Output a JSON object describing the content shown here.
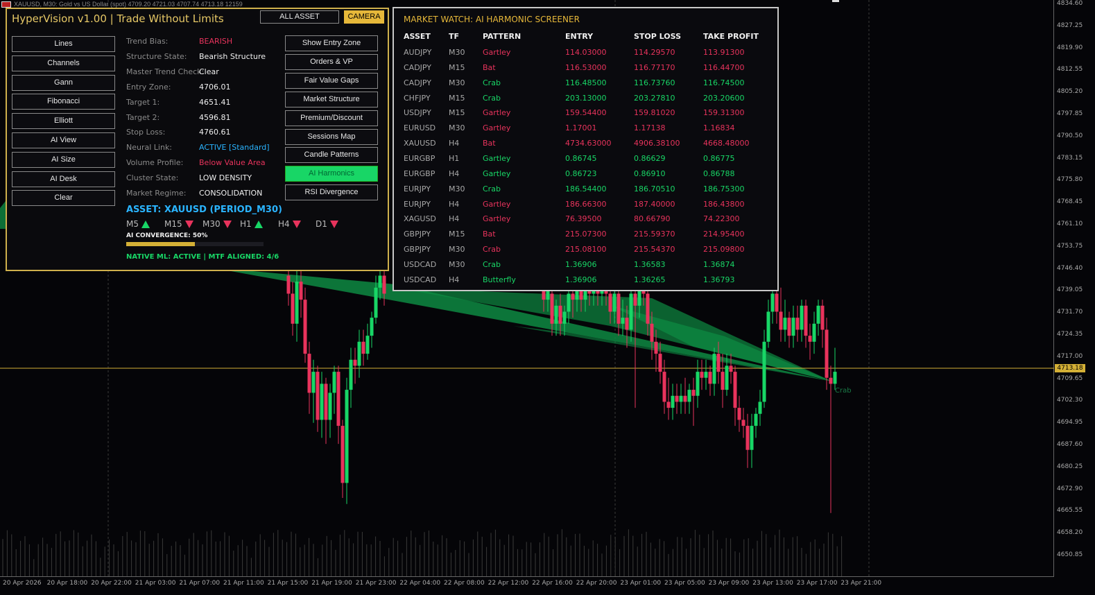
{
  "window": {
    "title": "XAUUSD, M30: Gold vs US Dollar (spot)  4709.20 4721.03 4707.74 4713.18  12159",
    "symbol_price": "4713.18"
  },
  "colors": {
    "bull": "#18d666",
    "bear": "#e8335c",
    "gold": "#d4b036",
    "fan": "#0e8a42",
    "grid": "#3a3a3a"
  },
  "price_axis": [
    "4834.60",
    "4827.25",
    "4819.90",
    "4812.55",
    "4805.20",
    "4797.85",
    "4790.50",
    "4783.15",
    "4775.80",
    "4768.45",
    "4761.10",
    "4753.75",
    "4746.40",
    "4739.05",
    "4731.70",
    "4724.35",
    "4717.00",
    "4709.65",
    "4702.30",
    "4694.95",
    "4687.60",
    "4680.25",
    "4672.90",
    "4665.55",
    "4658.20",
    "4650.85"
  ],
  "time_axis": [
    "20 Apr 2026",
    "20 Apr 18:00",
    "20 Apr 22:00",
    "21 Apr 03:00",
    "21 Apr 07:00",
    "21 Apr 11:00",
    "21 Apr 15:00",
    "21 Apr 19:00",
    "21 Apr 23:00",
    "22 Apr 04:00",
    "22 Apr 08:00",
    "22 Apr 12:00",
    "22 Apr 16:00",
    "22 Apr 20:00",
    "23 Apr 01:00",
    "23 Apr 05:00",
    "23 Apr 09:00",
    "23 Apr 13:00",
    "23 Apr 17:00",
    "23 Apr 21:00"
  ],
  "chart_label": "Crab",
  "hypervision": {
    "title": "HyperVision v1.00 | Trade Without Limits",
    "all_asset_label": "ALL ASSET",
    "camera_label": "CAMERA",
    "left_buttons": [
      "Lines",
      "Channels",
      "Gann",
      "Fibonacci",
      "Elliott",
      "AI View",
      "AI Size",
      "AI Desk",
      "Clear"
    ],
    "right_buttons": [
      "Show Entry Zone",
      "Orders & VP",
      "Fair Value Gaps",
      "Market Structure",
      "Premium/Discount",
      "Sessions Map",
      "Candle Patterns",
      "AI Harmonics",
      "RSI Divergence"
    ],
    "active_right_button": 7,
    "info": [
      {
        "label": "Trend Bias:",
        "value": "BEARISH",
        "color": "#e8335c"
      },
      {
        "label": "Structure State:",
        "value": "Bearish Structure",
        "color": "#f0f0f0"
      },
      {
        "label": "Master Trend Check:",
        "value": "Clear",
        "color": "#f0f0f0"
      },
      {
        "label": "Entry Zone:",
        "value": "4706.01",
        "color": "#f0f0f0"
      },
      {
        "label": "Target 1:",
        "value": "4651.41",
        "color": "#f0f0f0"
      },
      {
        "label": "Target 2:",
        "value": "4596.81",
        "color": "#f0f0f0"
      },
      {
        "label": "Stop Loss:",
        "value": "4760.61",
        "color": "#f0f0f0"
      },
      {
        "label": "Neural Link:",
        "value": "ACTIVE [Standard]",
        "color": "#2ab4ff"
      },
      {
        "label": "Volume Profile:",
        "value": "Below Value Area",
        "color": "#e8335c"
      },
      {
        "label": "Cluster State:",
        "value": "LOW DENSITY",
        "color": "#f0f0f0"
      },
      {
        "label": "Market Regime:",
        "value": "CONSOLIDATION",
        "color": "#f0f0f0"
      }
    ],
    "asset_line": "ASSET: XAUUSD (PERIOD_M30)",
    "timeframes": [
      {
        "tf": "M5",
        "dir": "up"
      },
      {
        "tf": "M15",
        "dir": "down"
      },
      {
        "tf": "M30",
        "dir": "down"
      },
      {
        "tf": "H1",
        "dir": "up"
      },
      {
        "tf": "H4",
        "dir": "down"
      },
      {
        "tf": "D1",
        "dir": "down"
      }
    ],
    "convergence_label": "AI CONVERGENCE: 50%",
    "convergence_value": 0.5,
    "native_line": "NATIVE ML: ACTIVE | MTF ALIGNED: 4/6"
  },
  "market_watch": {
    "title": "MARKET WATCH: AI HARMONIC SCREENER",
    "headers": [
      "ASSET",
      "TF",
      "PATTERN",
      "ENTRY",
      "STOP LOSS",
      "TAKE PROFIT"
    ],
    "rows": [
      {
        "asset": "AUDJPY",
        "tf": "M30",
        "pattern": "Gartley",
        "entry": "114.03000",
        "sl": "114.29570",
        "tp": "113.91300",
        "dir": "bear"
      },
      {
        "asset": "CADJPY",
        "tf": "M15",
        "pattern": "Bat",
        "entry": "116.53000",
        "sl": "116.77170",
        "tp": "116.44700",
        "dir": "bear"
      },
      {
        "asset": "CADJPY",
        "tf": "M30",
        "pattern": "Crab",
        "entry": "116.48500",
        "sl": "116.73760",
        "tp": "116.74500",
        "dir": "bull"
      },
      {
        "asset": "CHFJPY",
        "tf": "M15",
        "pattern": "Crab",
        "entry": "203.13000",
        "sl": "203.27810",
        "tp": "203.20600",
        "dir": "bull"
      },
      {
        "asset": "USDJPY",
        "tf": "M15",
        "pattern": "Gartley",
        "entry": "159.54400",
        "sl": "159.81020",
        "tp": "159.31300",
        "dir": "bear"
      },
      {
        "asset": "EURUSD",
        "tf": "M30",
        "pattern": "Gartley",
        "entry": "1.17001",
        "sl": "1.17138",
        "tp": "1.16834",
        "dir": "bear"
      },
      {
        "asset": "XAUUSD",
        "tf": "H4",
        "pattern": "Bat",
        "entry": "4734.63000",
        "sl": "4906.38100",
        "tp": "4668.48000",
        "dir": "bear"
      },
      {
        "asset": "EURGBP",
        "tf": "H1",
        "pattern": "Gartley",
        "entry": "0.86745",
        "sl": "0.86629",
        "tp": "0.86775",
        "dir": "bull"
      },
      {
        "asset": "EURGBP",
        "tf": "H4",
        "pattern": "Gartley",
        "entry": "0.86723",
        "sl": "0.86910",
        "tp": "0.86788",
        "dir": "bull"
      },
      {
        "asset": "EURJPY",
        "tf": "M30",
        "pattern": "Crab",
        "entry": "186.54400",
        "sl": "186.70510",
        "tp": "186.75300",
        "dir": "bull"
      },
      {
        "asset": "EURJPY",
        "tf": "H4",
        "pattern": "Gartley",
        "entry": "186.66300",
        "sl": "187.40000",
        "tp": "186.43800",
        "dir": "bear"
      },
      {
        "asset": "XAGUSD",
        "tf": "H4",
        "pattern": "Gartley",
        "entry": "76.39500",
        "sl": "80.66790",
        "tp": "74.22300",
        "dir": "bear"
      },
      {
        "asset": "GBPJPY",
        "tf": "M15",
        "pattern": "Bat",
        "entry": "215.07300",
        "sl": "215.59370",
        "tp": "214.95400",
        "dir": "bear"
      },
      {
        "asset": "GBPJPY",
        "tf": "M30",
        "pattern": "Crab",
        "entry": "215.08100",
        "sl": "215.54370",
        "tp": "215.09800",
        "dir": "bear"
      },
      {
        "asset": "USDCAD",
        "tf": "M30",
        "pattern": "Crab",
        "entry": "1.36906",
        "sl": "1.36583",
        "tp": "1.36874",
        "dir": "bull"
      },
      {
        "asset": "USDCAD",
        "tf": "H4",
        "pattern": "Butterfly",
        "entry": "1.36906",
        "sl": "1.36265",
        "tp": "1.36793",
        "dir": "bull"
      }
    ]
  }
}
